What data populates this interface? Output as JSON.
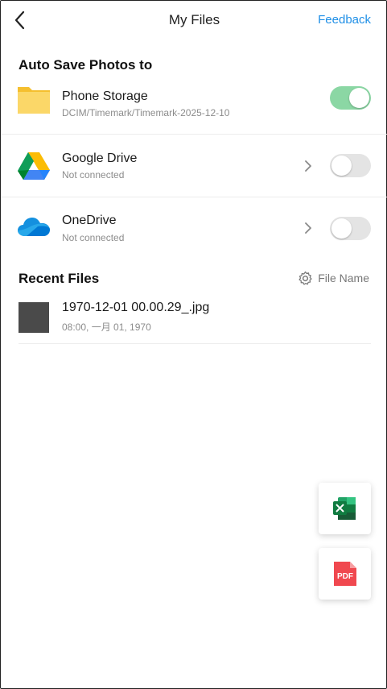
{
  "header": {
    "title": "My Files",
    "feedback_label": "Feedback"
  },
  "auto_save": {
    "section_title": "Auto Save Photos to",
    "items": [
      {
        "name": "Phone Storage",
        "subtitle": "DCIM/Timemark/Timemark-2025-12-10",
        "enabled": true,
        "icon": "folder-icon"
      },
      {
        "name": "Google Drive",
        "subtitle": "Not connected",
        "enabled": false,
        "icon": "google-drive-icon"
      },
      {
        "name": "OneDrive",
        "subtitle": "Not connected",
        "enabled": false,
        "icon": "onedrive-icon"
      }
    ]
  },
  "recent": {
    "section_title": "Recent Files",
    "sort_label": "File Name",
    "files": [
      {
        "name": "1970-12-01 00.00.29_.jpg",
        "meta": "08:00, 一月 01, 1970"
      }
    ]
  },
  "fabs": [
    {
      "icon": "excel-icon"
    },
    {
      "icon": "pdf-icon",
      "label": "PDF"
    }
  ],
  "colors": {
    "accent": "#1f8fe6",
    "toggle_on": "#8bd7a4",
    "toggle_off": "#e4e4e4",
    "pdf_red": "#f0484f",
    "excel_green": "#1e7145"
  }
}
